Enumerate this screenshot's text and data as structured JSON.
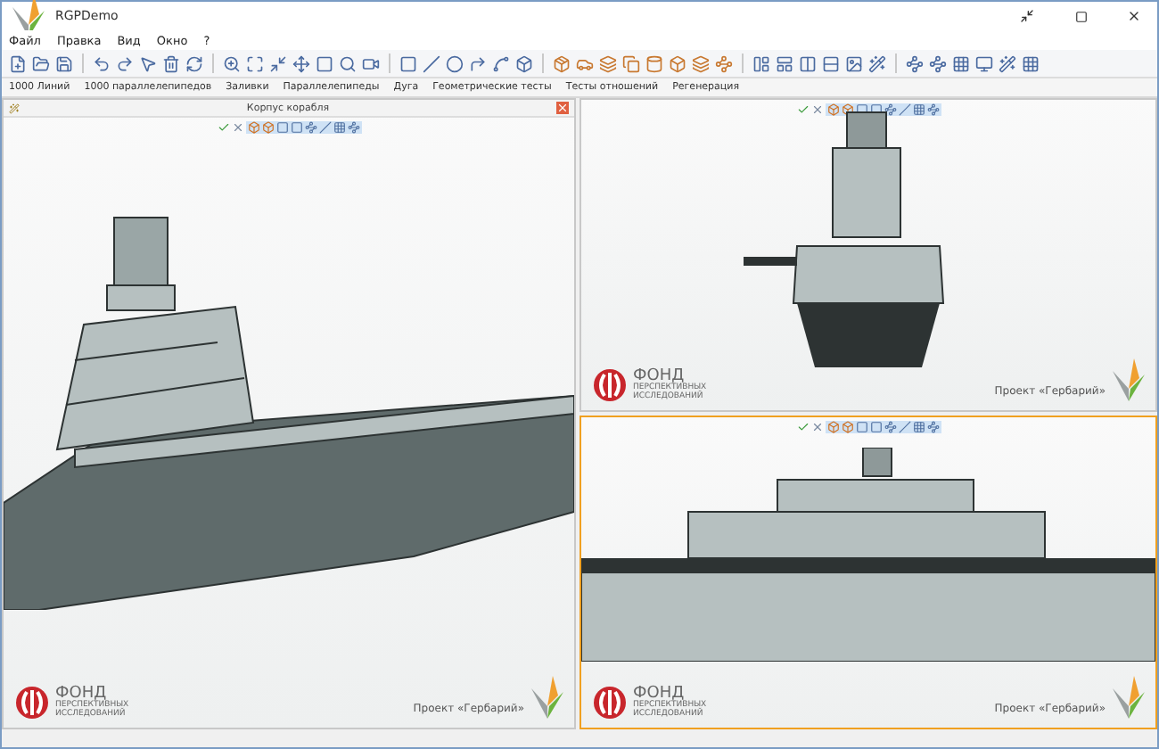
{
  "window": {
    "title": "RGPDemo"
  },
  "menu": [
    "Файл",
    "Правка",
    "Вид",
    "Окно",
    "?"
  ],
  "commands": [
    "1000 Линий",
    "1000 параллелепипедов",
    "Заливки",
    "Параллелепипеды",
    "Дуга",
    "Геометрические тесты",
    "Тесты отношений",
    "Регенерация"
  ],
  "viewports": [
    {
      "kind": "perspective",
      "title": "Корпус корабля",
      "active": false,
      "logo": {
        "name": "ФОНД",
        "line_1": "ПЕРСПЕКТИВНЫХ",
        "line_2": "ИССЛЕДОВАНИЙ"
      },
      "project": "Проект «Гербарий»"
    },
    {
      "kind": "front",
      "active": false,
      "logo": {
        "name": "ФОНД",
        "line_1": "ПЕРСПЕКТИВНЫХ",
        "line_2": "ИССЛЕДОВАНИЙ"
      },
      "project": "Проект «Гербарий»"
    },
    {
      "kind": "side",
      "active": true,
      "logo": {
        "name": "ФОНД",
        "line_1": "ПЕРСПЕКТИВНЫХ",
        "line_2": "ИССЛЕДОВАНИЙ"
      },
      "project": "Проект «Гербарий»"
    }
  ]
}
